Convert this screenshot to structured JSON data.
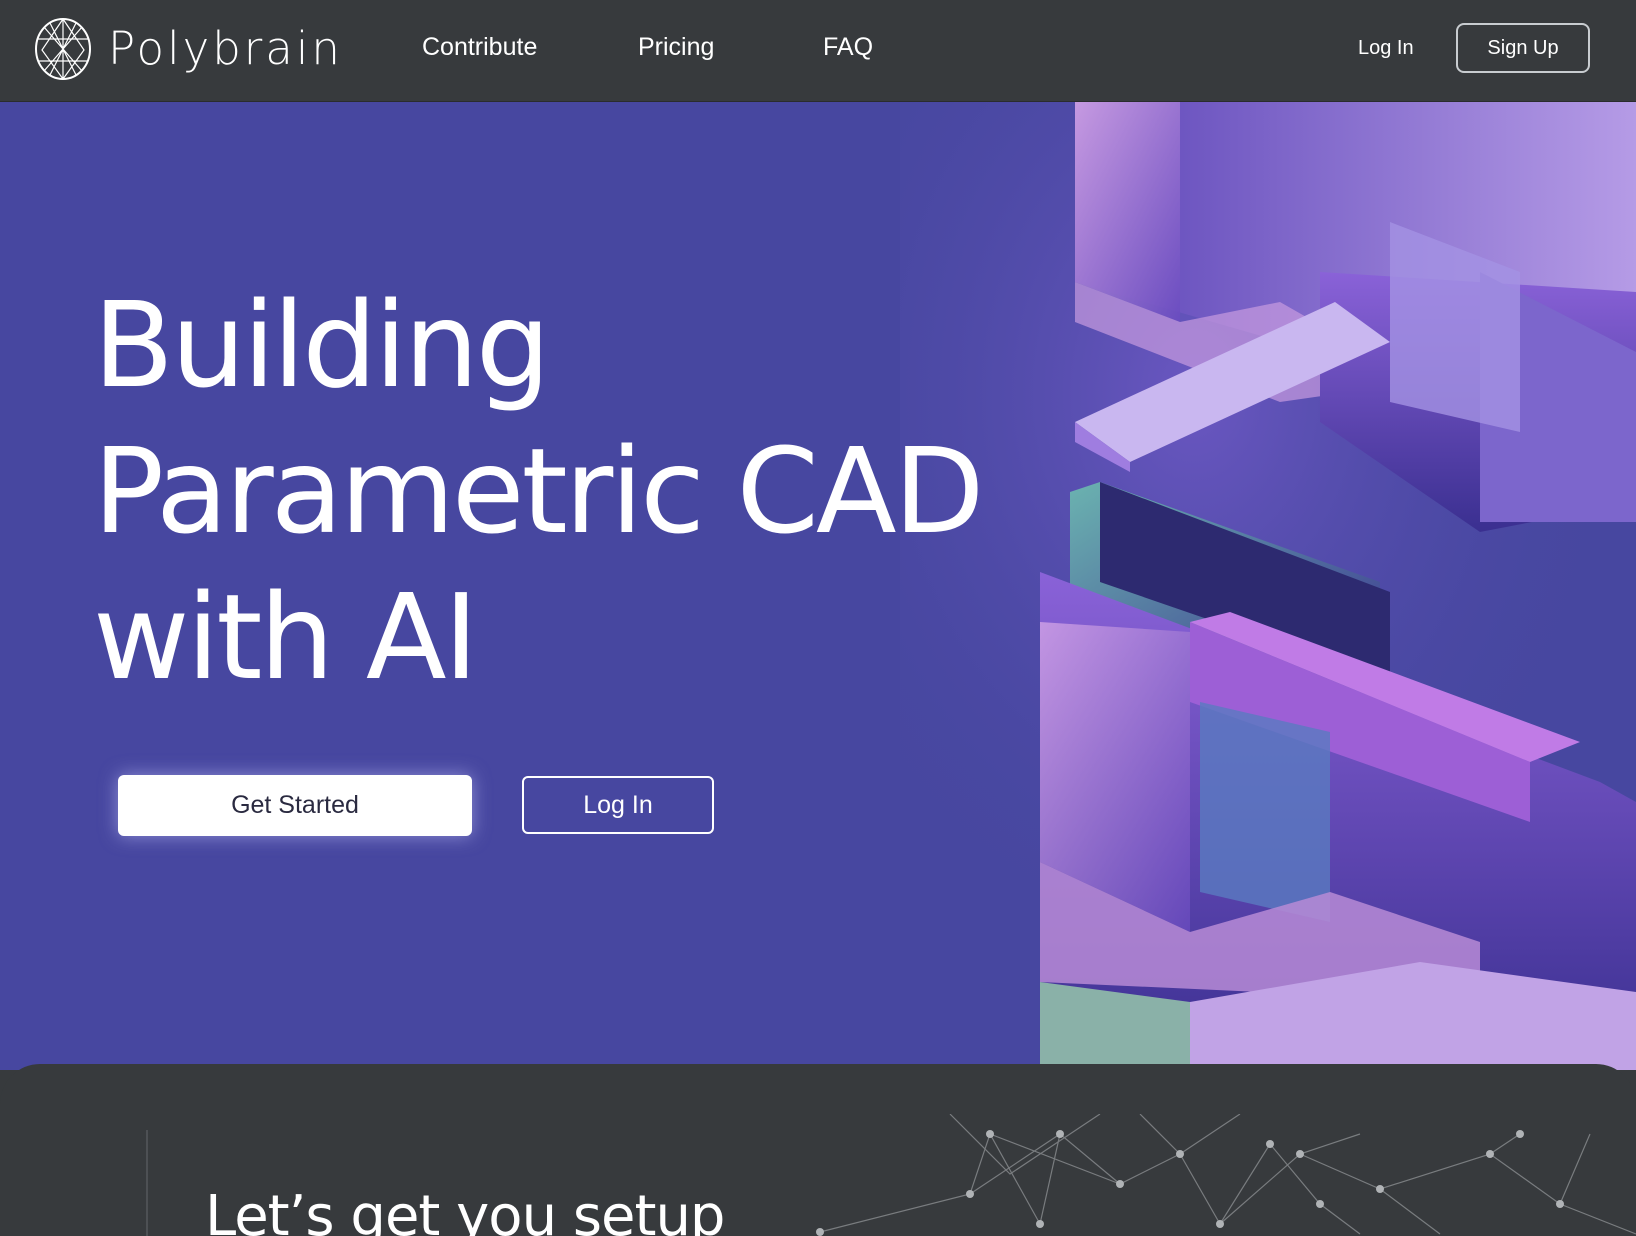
{
  "brand": {
    "name": "Polybrain"
  },
  "nav": {
    "links": [
      {
        "label": "Contribute"
      },
      {
        "label": "Pricing"
      },
      {
        "label": "FAQ"
      }
    ],
    "login_label": "Log In",
    "signup_label": "Sign Up"
  },
  "hero": {
    "headline_lines": [
      "Building",
      "Parametric CAD",
      "with AI"
    ],
    "primary_button": "Get Started",
    "secondary_button": "Log In"
  },
  "section2": {
    "title": "Let’s get you setup"
  },
  "colors": {
    "hero_bg": "#4747a0",
    "nav_bg": "#373a3d",
    "text": "#ffffff"
  },
  "icons": {
    "logo": "brain-globe-icon"
  }
}
